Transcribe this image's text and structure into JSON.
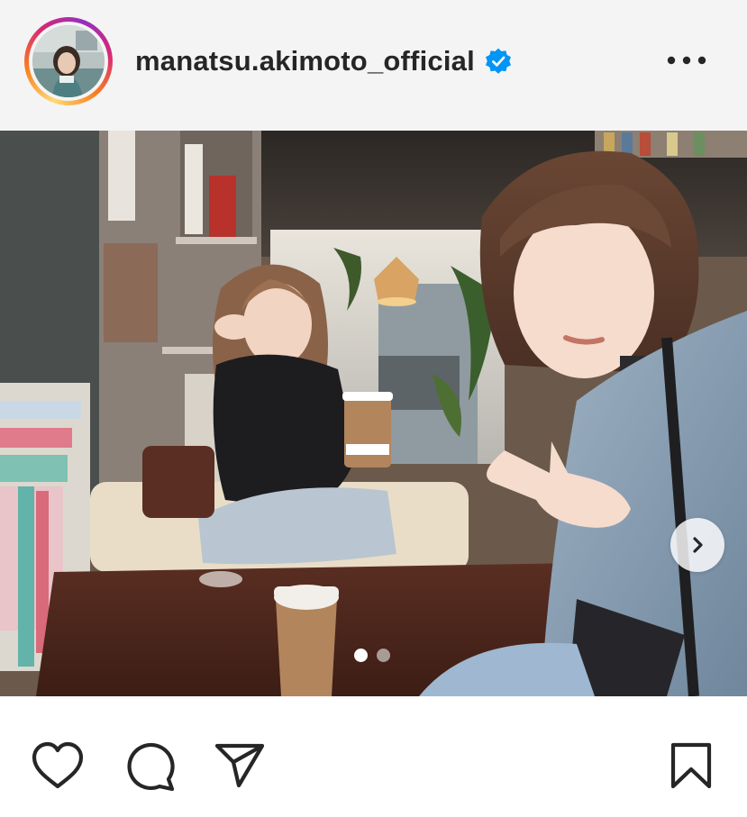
{
  "header": {
    "username": "manatsu.akimoto_official",
    "verified": true,
    "avatar": "profile-avatar",
    "more_icon": "more-horizontal-icon"
  },
  "carousel": {
    "current_index": 1,
    "total": 2,
    "next_icon": "chevron-right-icon"
  },
  "actions": [
    {
      "name": "like",
      "icon": "heart-icon"
    },
    {
      "name": "comment",
      "icon": "comment-bubble-icon"
    },
    {
      "name": "share",
      "icon": "paper-plane-icon"
    },
    {
      "name": "save",
      "icon": "bookmark-icon"
    }
  ],
  "colors": {
    "verified_badge": "#0095f6",
    "header_bg": "#f4f4f4",
    "icon_stroke": "#262626",
    "text": "#262626"
  }
}
